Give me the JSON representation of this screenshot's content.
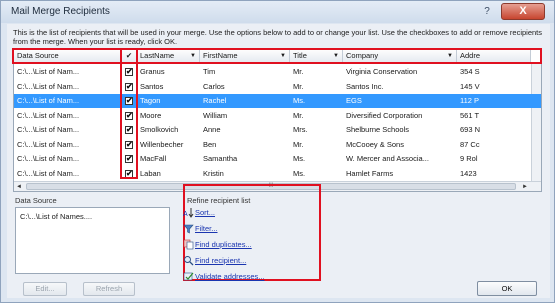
{
  "window": {
    "title": "Mail Merge Recipients",
    "help_glyph": "?",
    "close_glyph": "X",
    "instructions": "This is the list of recipients that will be used in your merge.  Use the options below to add to or change your list.  Use the checkboxes to add or remove recipients from the merge.  When your list is ready, click OK."
  },
  "table": {
    "columns": {
      "data_source": "Data Source",
      "check": "✔",
      "last_name": "LastName",
      "first_name": "FirstName",
      "title": "Title",
      "company": "Company",
      "address": "Addre"
    },
    "rows": [
      {
        "source": "C:\\...\\List of Nam...",
        "checked": "✔",
        "last": "Granus",
        "first": "Tim",
        "title": "Mr.",
        "company": "Virginia Conservation",
        "addr": "354 S"
      },
      {
        "source": "C:\\...\\List of Nam...",
        "checked": "✔",
        "last": "Santos",
        "first": "Carlos",
        "title": "Mr.",
        "company": "Santos Inc.",
        "addr": "145 V"
      },
      {
        "source": "C:\\...\\List of Nam...",
        "checked": "✔",
        "last": "Tagon",
        "first": "Rachel",
        "title": "Ms.",
        "company": "EGS",
        "addr": "112 P"
      },
      {
        "source": "C:\\...\\List of Nam...",
        "checked": "✔",
        "last": "Moore",
        "first": "William",
        "title": "Mr.",
        "company": "Diversified Corporation",
        "addr": "561 T"
      },
      {
        "source": "C:\\...\\List of Nam...",
        "checked": "✔",
        "last": "Smolkovich",
        "first": "Anne",
        "title": "Mrs.",
        "company": "Shelburne Schools",
        "addr": "693 N"
      },
      {
        "source": "C:\\...\\List of Nam...",
        "checked": "✔",
        "last": "Willenbecher",
        "first": "Ben",
        "title": "Mr.",
        "company": "McCooey & Sons",
        "addr": "87 Cc"
      },
      {
        "source": "C:\\...\\List of Nam...",
        "checked": "✔",
        "last": "MacFall",
        "first": "Samantha",
        "title": "Ms.",
        "company": "W. Mercer and Associa...",
        "addr": "9 Rol"
      },
      {
        "source": "C:\\...\\List of Nam...",
        "checked": "✔",
        "last": "Laban",
        "first": "Kristin",
        "title": "Ms.",
        "company": "Hamlet Farms",
        "addr": "1423"
      }
    ],
    "selected_row": 2,
    "scroll_thumb_grip": "III"
  },
  "data_source_panel": {
    "label": "Data Source",
    "item": "C:\\...\\List of Names....",
    "edit_label": "Edit...",
    "refresh_label": "Refresh"
  },
  "refine": {
    "label": "Refine recipient list",
    "links": {
      "sort": "Sort...",
      "filter": "Filter...",
      "find_duplicates": "Find duplicates...",
      "find_recipient": "Find recipient...",
      "validate": "Validate addresses..."
    }
  },
  "ok_label": "OK",
  "colors": {
    "highlight_border": "#e01020",
    "selected_row": "#3399ff",
    "link": "#1a35b0"
  }
}
